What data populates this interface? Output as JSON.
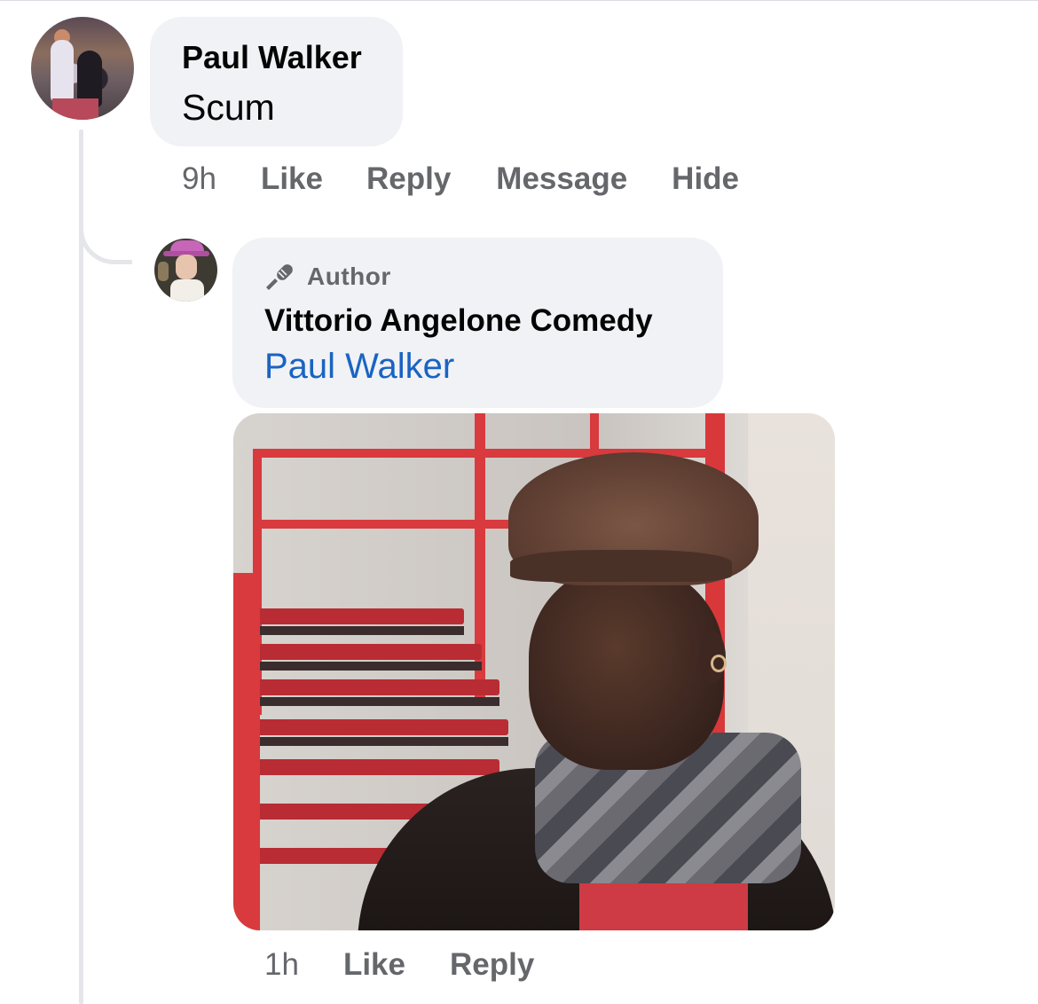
{
  "comment_1": {
    "author": "Paul Walker",
    "text": "Scum",
    "time": "9h",
    "actions": [
      "Like",
      "Reply",
      "Message",
      "Hide"
    ]
  },
  "reply_1": {
    "badge": "Author",
    "author": "Vittorio Angelone Comedy",
    "mention": "Paul Walker",
    "time": "1h",
    "actions": [
      "Like",
      "Reply"
    ],
    "attachment_icon": "photo"
  },
  "colors": {
    "bubble": "#f0f2f5",
    "meta_text": "#65676b",
    "mention_link": "#1a63c3",
    "thread_line": "#e4e6ea"
  }
}
